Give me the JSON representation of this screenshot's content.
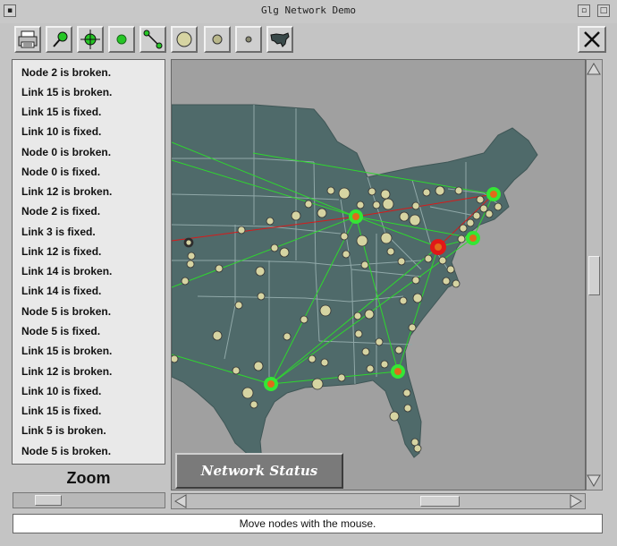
{
  "window": {
    "title": "Glg Network Demo"
  },
  "toolbar": {
    "buttons": [
      {
        "name": "print-button",
        "icon": "printer-icon"
      },
      {
        "name": "move-node-button",
        "icon": "pin-icon"
      },
      {
        "name": "crosshair-button",
        "icon": "crosshair-icon"
      },
      {
        "name": "add-node-button",
        "icon": "green-node-icon"
      },
      {
        "name": "add-link-button",
        "icon": "link-icon"
      },
      {
        "name": "large-node-button",
        "icon": "large-circle-icon"
      },
      {
        "name": "medium-node-button",
        "icon": "medium-circle-icon"
      },
      {
        "name": "small-node-button",
        "icon": "small-circle-icon"
      },
      {
        "name": "map-button",
        "icon": "us-map-icon"
      }
    ],
    "close_icon": "close-icon"
  },
  "log": {
    "items": [
      "Node 2 is broken.",
      "Link 15 is broken.",
      "Link 15 is fixed.",
      "Link 10 is fixed.",
      "Node 0 is broken.",
      "Node 0 is fixed.",
      "Link 12 is broken.",
      "Node 2 is fixed.",
      "Link 3 is fixed.",
      "Link 12 is fixed.",
      "Link 14 is broken.",
      "Link 14 is fixed.",
      "Node 5 is broken.",
      "Node 5 is fixed.",
      "Link 15 is broken.",
      "Link 12 is broken.",
      "Link 10 is fixed.",
      "Link 15 is fixed.",
      "Link 5 is broken.",
      "Node 5 is broken."
    ]
  },
  "zoom": {
    "label": "Zoom"
  },
  "map": {
    "network_button_label": "Network Status",
    "colors": {
      "land": "#4f6a6a",
      "ocean": "#a0a0a0",
      "border": "#9aadad",
      "link_ok": "#2ed82e",
      "link_broken": "#d81a1a",
      "node_ok": "#35e635",
      "node_broken": "#e01818",
      "node_core": "#e06a1a",
      "city": "#d6d4a2"
    },
    "hubs": [
      {
        "name": "hub-chicago",
        "status": "ok"
      },
      {
        "name": "hub-boston",
        "status": "ok"
      },
      {
        "name": "hub-new-york",
        "status": "ok"
      },
      {
        "name": "hub-washington",
        "status": "broken"
      },
      {
        "name": "hub-houston",
        "status": "ok"
      },
      {
        "name": "hub-jacksonville",
        "status": "ok"
      }
    ]
  },
  "status": {
    "text": "Move nodes with the mouse."
  }
}
